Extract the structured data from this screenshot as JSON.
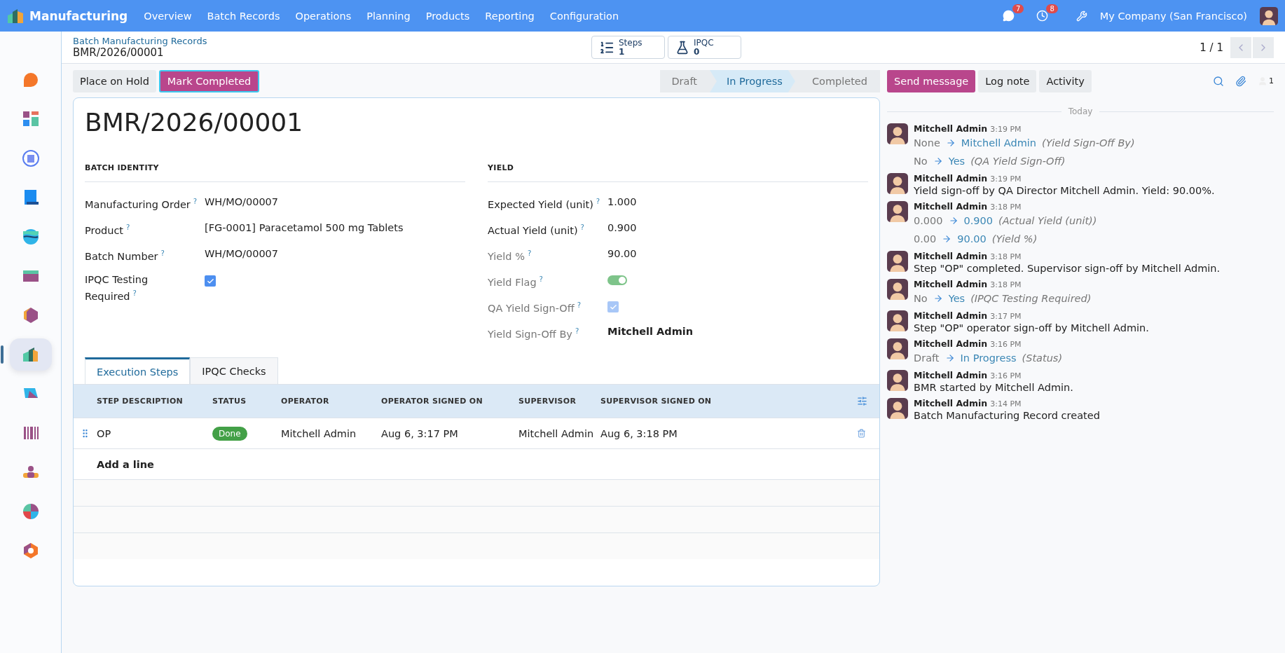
{
  "navbar": {
    "app_name": "Manufacturing",
    "menu": [
      "Overview",
      "Batch Records",
      "Operations",
      "Planning",
      "Products",
      "Reporting",
      "Configuration"
    ],
    "messages_badge": "7",
    "activities_badge": "8",
    "company": "My Company (San Francisco)"
  },
  "sidebar": {
    "apps": [
      {
        "kind": "bubble",
        "selected": false
      },
      {
        "kind": "tiles",
        "selected": false
      },
      {
        "kind": "globe",
        "selected": false
      },
      {
        "kind": "invoice",
        "selected": false
      },
      {
        "kind": "wave",
        "selected": false
      },
      {
        "kind": "card",
        "selected": false
      },
      {
        "kind": "cube",
        "selected": false
      },
      {
        "kind": "factory",
        "selected": true
      },
      {
        "kind": "tag",
        "selected": false
      },
      {
        "kind": "barcode",
        "selected": false
      },
      {
        "kind": "people",
        "selected": false
      },
      {
        "kind": "pie",
        "selected": false
      },
      {
        "kind": "hexagon",
        "selected": false
      }
    ]
  },
  "breadcrumb": {
    "parent": "Batch Manufacturing Records",
    "current": "BMR/2026/00001"
  },
  "smart_buttons": [
    {
      "kind": "list",
      "label": "Steps",
      "count": "1"
    },
    {
      "kind": "flask",
      "label": "IPQC",
      "count": "0"
    }
  ],
  "pager": "1 / 1",
  "actions": [
    {
      "label": "Place on Hold",
      "kind": "secondary"
    },
    {
      "label": "Mark Completed",
      "kind": "primary"
    }
  ],
  "stages": [
    {
      "label": "Draft",
      "selected": false
    },
    {
      "label": "In Progress",
      "selected": true
    },
    {
      "label": "Completed",
      "selected": false
    }
  ],
  "form": {
    "title": "BMR/2026/00001",
    "groups": [
      {
        "heading": "BATCH IDENTITY",
        "fields": [
          {
            "label": "Manufacturing Order",
            "help": "?",
            "kind": "text",
            "readonly": false,
            "value": "WH/MO/00007"
          },
          {
            "label": "Product",
            "help": "?",
            "kind": "text",
            "readonly": false,
            "value": "[FG-0001] Paracetamol 500 mg Tablets"
          },
          {
            "label": "Batch Number",
            "help": "?",
            "kind": "text",
            "readonly": false,
            "value": "WH/MO/00007"
          },
          {
            "label": "IPQC Testing Required",
            "help": "?",
            "kind": "checkbox",
            "readonly": false,
            "checked": true
          }
        ]
      },
      {
        "heading": "YIELD",
        "fields": [
          {
            "label": "Expected Yield (unit)",
            "help": "?",
            "kind": "text",
            "readonly": false,
            "value": "1.000"
          },
          {
            "label": "Actual Yield (unit)",
            "help": "?",
            "kind": "text",
            "readonly": false,
            "value": "0.900"
          },
          {
            "label": "Yield %",
            "help": "?",
            "kind": "text",
            "readonly": true,
            "value": "90.00"
          },
          {
            "label": "Yield Flag",
            "help": "?",
            "kind": "toggle",
            "readonly": true,
            "on": true
          },
          {
            "label": "QA Yield Sign-Off",
            "help": "?",
            "kind": "checkbox",
            "readonly": true,
            "checked": true
          },
          {
            "label": "Yield Sign-Off By",
            "help": "?",
            "kind": "person",
            "readonly": true,
            "value": "Mitchell Admin"
          }
        ]
      }
    ]
  },
  "notebook": {
    "tabs": [
      {
        "label": "Execution Steps",
        "selected": true
      },
      {
        "label": "IPQC Checks",
        "selected": false
      }
    ],
    "columns": [
      "STEP DESCRIPTION",
      "STATUS",
      "OPERATOR",
      "OPERATOR SIGNED ON",
      "SUPERVISOR",
      "SUPERVISOR SIGNED ON"
    ],
    "rows": [
      {
        "step": "OP",
        "status": "Done",
        "operator": "Mitchell Admin",
        "operator_signed_on": "Aug 6, 3:17 PM",
        "supervisor": "Mitchell Admin",
        "supervisor_signed_on": "Aug 6, 3:18 PM"
      }
    ],
    "add_line": "Add a line"
  },
  "chatter": {
    "buttons": [
      {
        "label": "Send message",
        "selected": true
      },
      {
        "label": "Log note",
        "selected": false
      },
      {
        "label": "Activity",
        "selected": false
      }
    ],
    "followers": "1",
    "date": "Today",
    "messages": [
      {
        "author": "Mitchell Admin",
        "time": "3:19 PM",
        "kind": "changes",
        "changes": [
          {
            "old": "None",
            "new": "Mitchell Admin",
            "field": "(Yield Sign-Off By)"
          },
          {
            "old": "No",
            "new": "Yes",
            "field": "(QA Yield Sign-Off)"
          }
        ]
      },
      {
        "author": "Mitchell Admin",
        "time": "3:19 PM",
        "kind": "text",
        "body": "Yield sign-off by QA Director Mitchell Admin. Yield: 90.00%."
      },
      {
        "author": "Mitchell Admin",
        "time": "3:18 PM",
        "kind": "changes",
        "changes": [
          {
            "old": "0.000",
            "new": "0.900",
            "field": "(Actual Yield (unit))"
          },
          {
            "old": "0.00",
            "new": "90.00",
            "field": "(Yield %)"
          }
        ]
      },
      {
        "author": "Mitchell Admin",
        "time": "3:18 PM",
        "kind": "text",
        "body": "Step \"OP\" completed. Supervisor sign-off by Mitchell Admin."
      },
      {
        "author": "Mitchell Admin",
        "time": "3:18 PM",
        "kind": "changes",
        "changes": [
          {
            "old": "No",
            "new": "Yes",
            "field": "(IPQC Testing Required)"
          }
        ]
      },
      {
        "author": "Mitchell Admin",
        "time": "3:17 PM",
        "kind": "text",
        "body": "Step \"OP\" operator sign-off by Mitchell Admin."
      },
      {
        "author": "Mitchell Admin",
        "time": "3:16 PM",
        "kind": "changes",
        "changes": [
          {
            "old": "Draft",
            "new": "In Progress",
            "field": "(Status)"
          }
        ]
      },
      {
        "author": "Mitchell Admin",
        "time": "3:16 PM",
        "kind": "text",
        "body": "BMR started by Mitchell Admin."
      },
      {
        "author": "Mitchell Admin",
        "time": "3:14 PM",
        "kind": "text",
        "body": "Batch Manufacturing Record created"
      }
    ]
  }
}
